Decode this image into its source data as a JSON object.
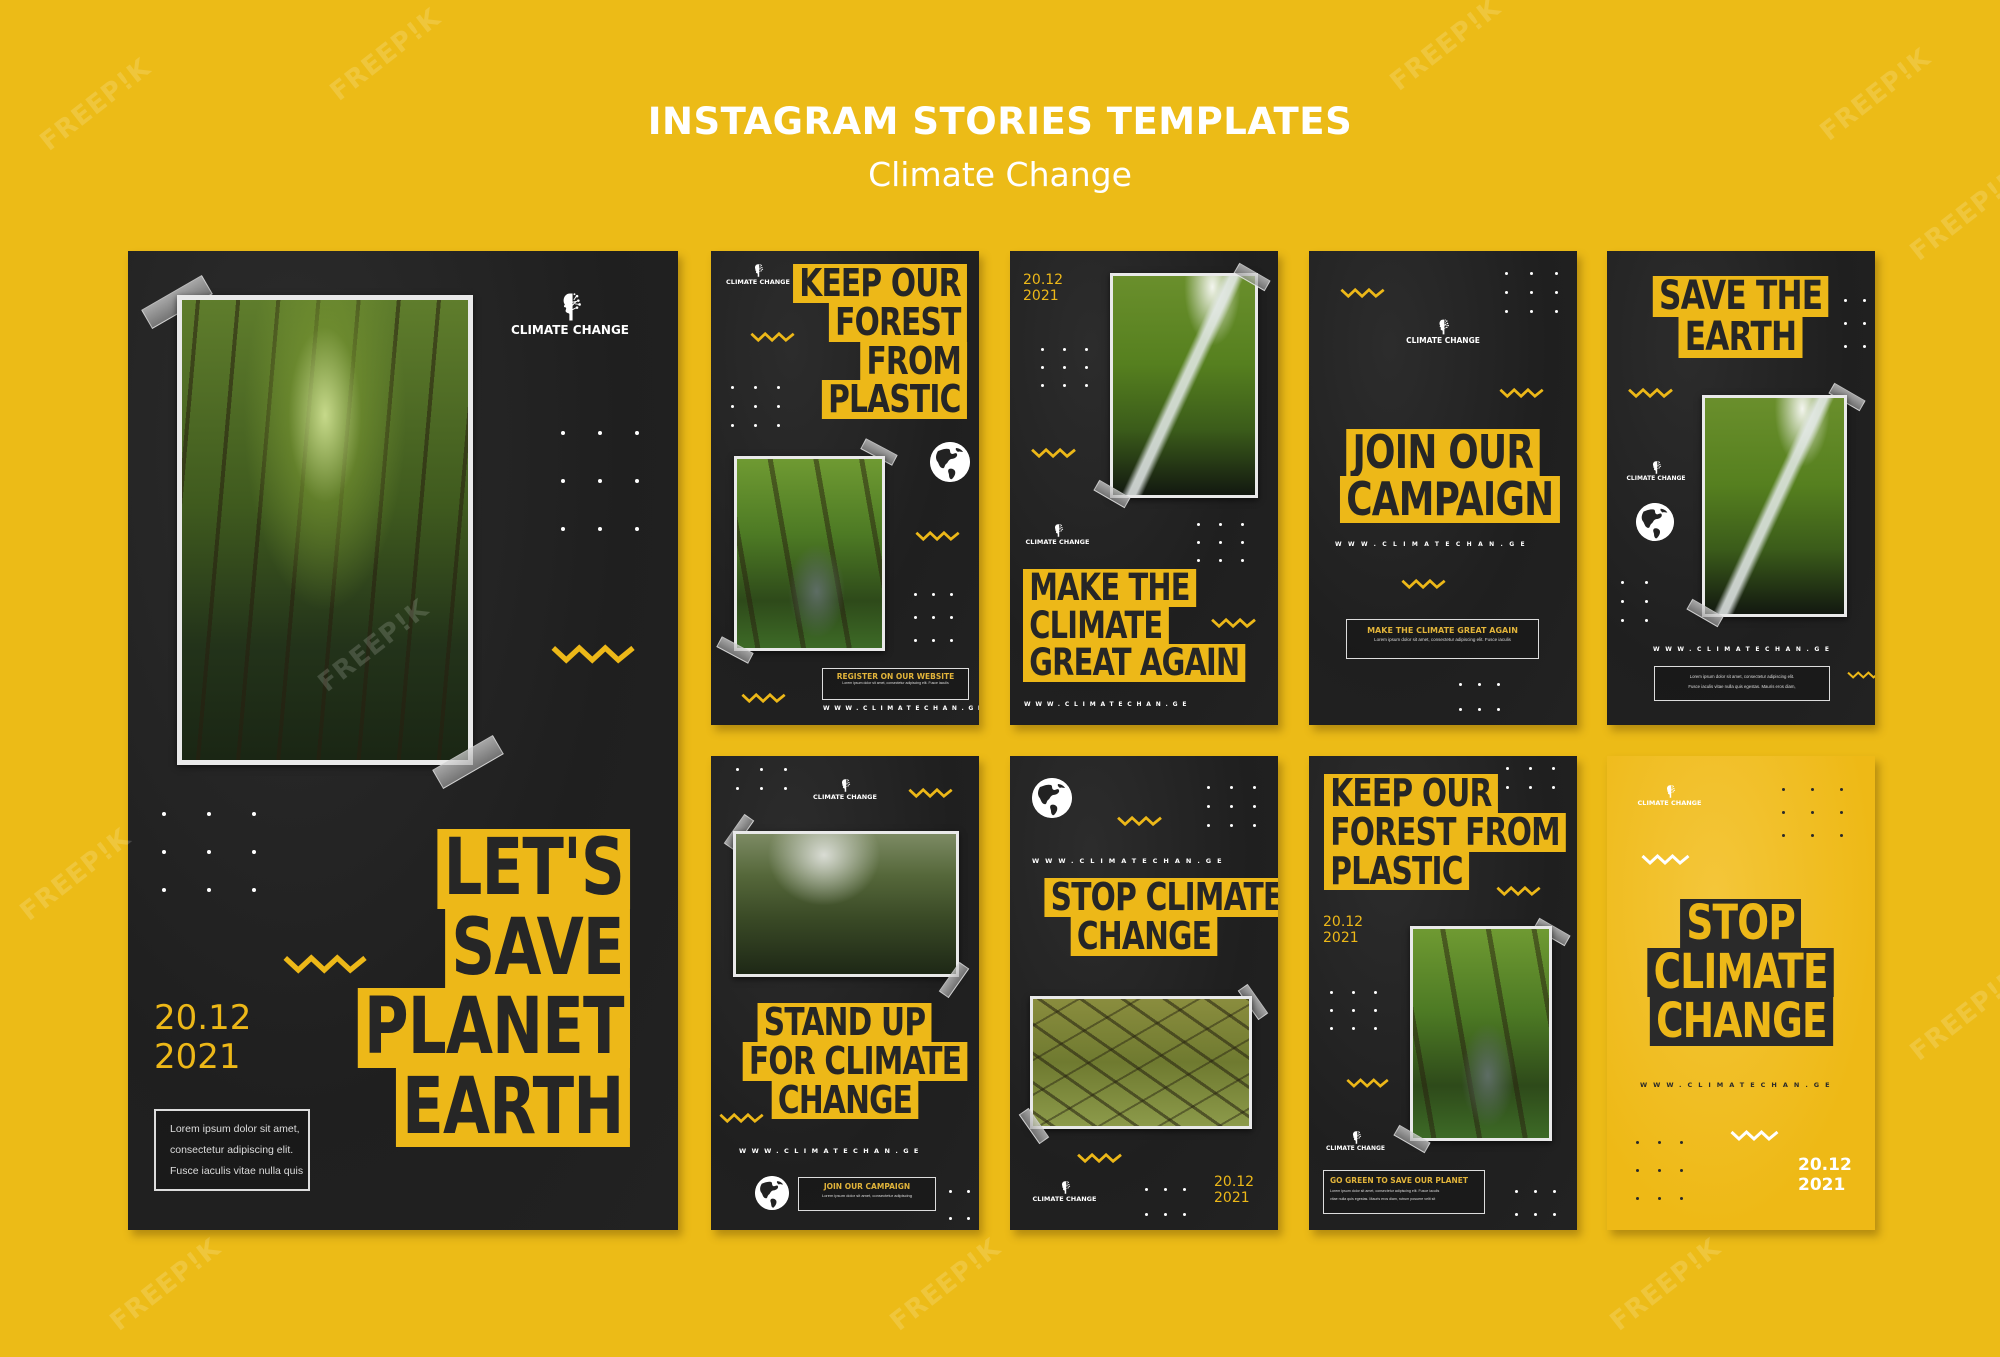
{
  "header": {
    "title": "INSTAGRAM STORIES TEMPLATES",
    "subtitle": "Climate Change"
  },
  "colors": {
    "background_yellow": "#ecbb17",
    "card_dark": "#232323",
    "accent_yellow": "#edb818",
    "text_dark": "#262626",
    "white": "#ffffff"
  },
  "brand": {
    "logo_text": "CLIMATE CHANGE",
    "logo_icon": "tree-head-icon"
  },
  "watermark": "FREEP!K",
  "cards": [
    {
      "id": "lets-save-planet-earth",
      "headline": [
        "LET'S",
        "SAVE",
        "PLANET",
        "EARTH"
      ],
      "date": [
        "20.12",
        "2021"
      ],
      "logo": "CLIMATE CHANGE",
      "body_lines": [
        "Lorem ipsum dolor sit amet,",
        "consectetur adipiscing elit.",
        "Fusce iaculis vitae nulla quis"
      ],
      "photo": "forest"
    },
    {
      "id": "keep-our-forest-1",
      "headline": [
        "KEEP OUR",
        "FOREST",
        "FROM",
        "PLASTIC"
      ],
      "logo": "CLIMATE CHANGE",
      "box_title": "REGISTER ON OUR WEBSITE",
      "box_body": "Lorem ipsum dolor sit amet, consectetur adipiscing elit. Fusce iaculis",
      "url": "WWW.CLIMATECHAN.GE",
      "photo": "forest stream"
    },
    {
      "id": "make-climate-great-again",
      "headline": [
        "MAKE THE",
        "CLIMATE",
        "GREAT AGAIN"
      ],
      "date": [
        "20.12",
        "2021"
      ],
      "logo": "CLIMATE CHANGE",
      "url": "WWW.CLIMATECHAN.GE",
      "photo": "waterfall"
    },
    {
      "id": "join-our-campaign",
      "headline": [
        "JOIN OUR",
        "CAMPAIGN"
      ],
      "logo": "CLIMATE CHANGE",
      "url": "WWW.CLIMATECHAN.GE",
      "box_title": "MAKE THE CLIMATE GREAT AGAIN",
      "box_body": "Lorem ipsum dolor sit amet, consectetur adipiscing elit. Fusce iaculis"
    },
    {
      "id": "save-the-earth",
      "headline": [
        "SAVE THE",
        "EARTH"
      ],
      "logo": "CLIMATE CHANGE",
      "url": "WWW.CLIMATECHAN.GE",
      "body_lines": [
        "Lorem ipsum dolor sit amet, consectetur adipiscing elit.",
        "Fusce iaculis vitae nulla quis egestas. Mauris eros diam,"
      ],
      "photo": "waterfall"
    },
    {
      "id": "stand-up-for-climate-change",
      "headline": [
        "STAND UP",
        "FOR CLIMATE",
        "CHANGE"
      ],
      "logo": "CLIMATE CHANGE",
      "url": "WWW.CLIMATECHAN.GE",
      "box_title": "JOIN OUR CAMPAIGN",
      "box_body": "Lorem ipsum dolor sit amet, consectetur adipiscing",
      "photo": "ferns"
    },
    {
      "id": "stop-climate-change-dark",
      "headline": [
        "STOP CLIMATE",
        "CHANGE"
      ],
      "url": "WWW.CLIMATECHAN.GE",
      "date": [
        "20.12",
        "2021"
      ],
      "logo": "CLIMATE CHANGE",
      "photo": "oak tree"
    },
    {
      "id": "keep-our-forest-2",
      "headline": [
        "KEEP OUR",
        "FOREST FROM",
        "PLASTIC"
      ],
      "date": [
        "20.12",
        "2021"
      ],
      "logo": "CLIMATE CHANGE",
      "box_title": "GO GREEN TO SAVE OUR PLANET",
      "body_lines": [
        "Lorem ipsum dolor sit amet, consectetur adipiscing elit. Fusce iaculis",
        "vitae nulla quis egestas. Mauris eros diam, rutrum posuere velit sit"
      ],
      "photo": "forest stream"
    },
    {
      "id": "stop-climate-change-yellow",
      "headline": [
        "STOP",
        "CLIMATE",
        "CHANGE"
      ],
      "logo": "CLIMATE CHANGE",
      "url": "WWW.CLIMATECHAN.GE",
      "date": [
        "20.12",
        "2021"
      ]
    }
  ]
}
